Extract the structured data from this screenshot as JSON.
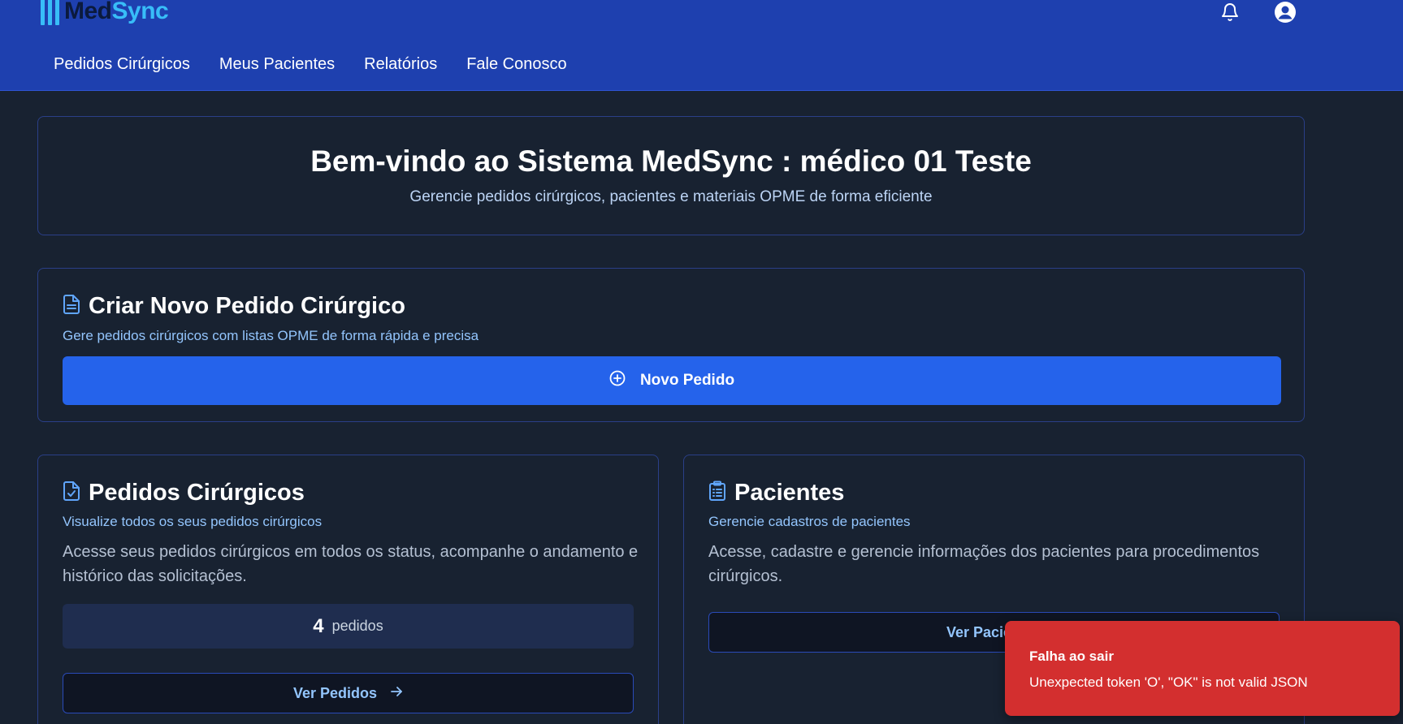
{
  "header": {
    "logo_med": "Med",
    "logo_sync": "Sync",
    "nav": [
      {
        "label": "Pedidos Cirúrgicos"
      },
      {
        "label": "Meus Pacientes"
      },
      {
        "label": "Relatórios"
      },
      {
        "label": "Fale Conosco"
      }
    ]
  },
  "welcome": {
    "title": "Bem-vindo ao Sistema MedSync : médico 01 Teste",
    "subtitle": "Gerencie pedidos cirúrgicos, pacientes e materiais OPME de forma eficiente"
  },
  "create_order": {
    "title": "Criar Novo Pedido Cirúrgico",
    "subtitle": "Gere pedidos cirúrgicos com listas OPME de forma rápida e precisa",
    "button_label": "Novo Pedido"
  },
  "orders_card": {
    "title": "Pedidos Cirúrgicos",
    "subtitle": "Visualize todos os seus pedidos cirúrgicos",
    "description": "Acesse seus pedidos cirúrgicos em todos os status, acompanhe o andamento e histórico das solicitações.",
    "count": "4",
    "count_label": "pedidos",
    "button_label": "Ver Pedidos"
  },
  "patients_card": {
    "title": "Pacientes",
    "subtitle": "Gerencie cadastros de pacientes",
    "description": "Acesse, cadastre e gerencie informações dos pacientes para procedimentos cirúrgicos.",
    "button_label": "Ver Pacientes"
  },
  "toast": {
    "title": "Falha ao sair",
    "message": "Unexpected token 'O', \"OK\" is not valid JSON"
  },
  "colors": {
    "header_bg": "#1e40af",
    "page_bg": "#182231",
    "primary": "#2563eb",
    "accent": "#93c5fd",
    "toast_bg": "#d32f2f"
  },
  "icons": {
    "bell": "bell-icon",
    "user": "user-circle-icon",
    "document": "document-icon",
    "plus_circle": "plus-circle-icon",
    "document_check": "document-check-icon",
    "clipboard": "clipboard-list-icon",
    "arrow_right": "arrow-right-icon"
  }
}
